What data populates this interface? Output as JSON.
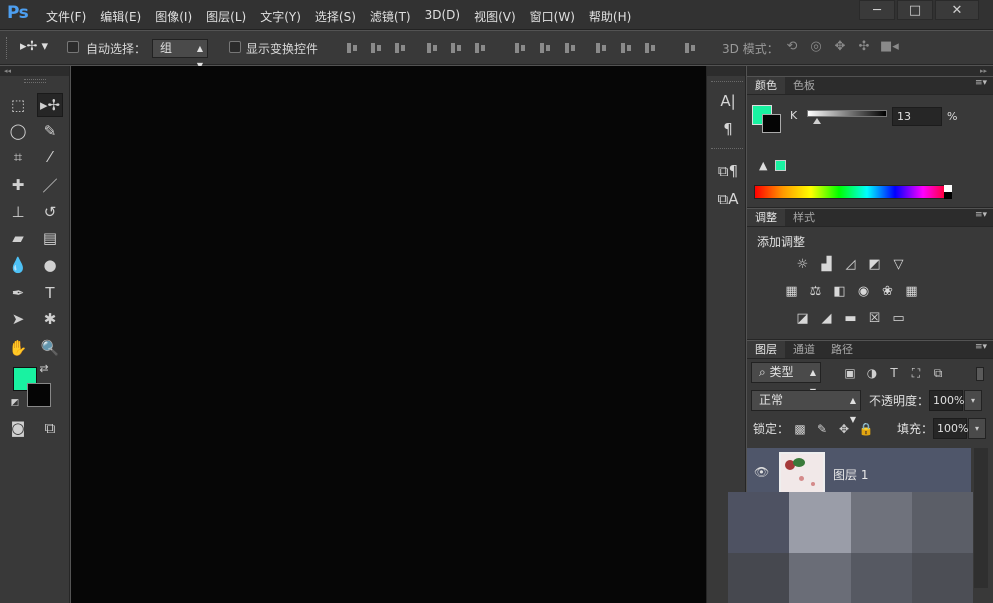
{
  "app": {
    "logo": "Ps",
    "menu": [
      "文件(F)",
      "编辑(E)",
      "图像(I)",
      "图层(L)",
      "文字(Y)",
      "选择(S)",
      "滤镜(T)",
      "3D(D)",
      "视图(V)",
      "窗口(W)",
      "帮助(H)"
    ],
    "window_controls": {
      "minimize": "─",
      "restore": "□",
      "close": "✕"
    }
  },
  "options_bar": {
    "auto_select_label": "自动选择：",
    "auto_select_value": "组",
    "show_transform_label": "显示变换控件",
    "mode_3d_label": "3D 模式："
  },
  "tools": {
    "foreground_color": "#19f2a1",
    "background_color": "#050505"
  },
  "color_panel": {
    "tabs": [
      "颜色",
      "色板"
    ],
    "channel_label": "K",
    "channel_value": "13",
    "unit": "%",
    "slider_level_percent": 13,
    "foreground_color": "#19f2a1"
  },
  "adjustments_panel": {
    "tabs": [
      "调整",
      "样式"
    ],
    "title": "添加调整"
  },
  "layers_panel": {
    "tabs": [
      "图层",
      "通道",
      "路径"
    ],
    "filter_value": "类型",
    "blend_mode": "正常",
    "opacity_label": "不透明度：",
    "opacity_value": "100%",
    "lock_label": "锁定：",
    "fill_label": "填充：",
    "fill_value": "100%",
    "layers": [
      {
        "name": "图层 1",
        "visible": true
      }
    ]
  },
  "colors": {
    "accent": "#4d9ff0",
    "selected_layer": "#4f566a",
    "canvas": "#060606"
  }
}
